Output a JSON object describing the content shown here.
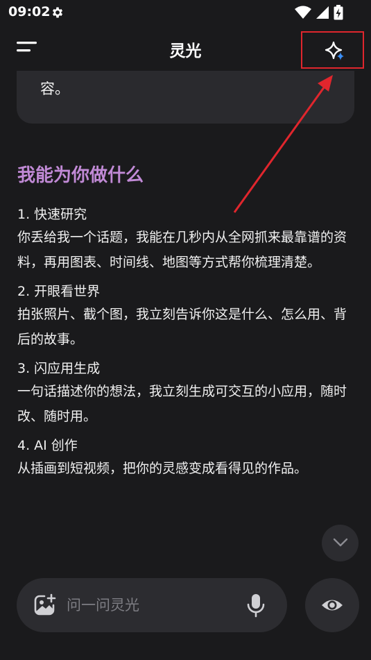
{
  "status_bar": {
    "time": "09:02"
  },
  "header": {
    "title": "灵光"
  },
  "prev_message": {
    "text": "容。"
  },
  "section": {
    "heading": "我能为你做什么",
    "items": [
      {
        "title": "1. 快速研究",
        "desc": "你丢给我一个话题，我能在几秒内从全网抓来最靠谱的资料，再用图表、时间线、地图等方式帮你梳理清楚。"
      },
      {
        "title": "2. 开眼看世界",
        "desc": "拍张照片、截个图，我立刻告诉你这是什么、怎么用、背后的故事。"
      },
      {
        "title": "3. 闪应用生成",
        "desc": "一句话描述你的想法，我立刻生成可交互的小应用，随时改、随时用。"
      },
      {
        "title": "4. AI 创作",
        "desc": "从插画到短视频，把你的灵感变成看得见的作品。"
      }
    ]
  },
  "input": {
    "placeholder": "问一问灵光"
  },
  "colors": {
    "background": "#1a1a1c",
    "heading_accent": "#c18ad6",
    "annotation_red": "#e0262d",
    "spark_blue": "#3a8ef6"
  },
  "icons": {
    "status": [
      "gear-icon",
      "wifi-icon",
      "signal-icon",
      "battery-icon"
    ],
    "header": [
      "menu-icon",
      "sparkle-icon"
    ],
    "input": [
      "image-add-icon",
      "mic-icon",
      "eye-icon"
    ],
    "scroll": "chevron-down-icon"
  }
}
